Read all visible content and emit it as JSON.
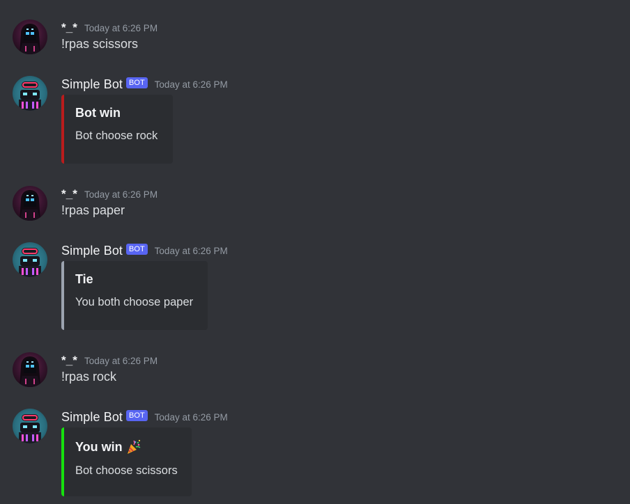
{
  "colors": {
    "background": "#313338",
    "embed_background": "#2b2d31",
    "bot_tag": "#5865f2",
    "embed_loss": "#b91c1c",
    "embed_tie": "#9ca3af",
    "embed_win": "#16e10e"
  },
  "messages": [
    {
      "author": "*_*",
      "timestamp": "Today at 6:26 PM",
      "content": "!rpas scissors",
      "avatar_icon": "hooded-figure-avatar-icon"
    },
    {
      "author": "Simple Bot",
      "bot_tag": "BOT",
      "timestamp": "Today at 6:26 PM",
      "avatar_icon": "robot-avatar-icon",
      "embed": {
        "title": "Bot win",
        "description": "Bot choose rock",
        "accent": "#b91c1c"
      }
    },
    {
      "author": "*_*",
      "timestamp": "Today at 6:26 PM",
      "content": "!rpas paper",
      "avatar_icon": "hooded-figure-avatar-icon"
    },
    {
      "author": "Simple Bot",
      "bot_tag": "BOT",
      "timestamp": "Today at 6:26 PM",
      "avatar_icon": "robot-avatar-icon",
      "embed": {
        "title": "Tie",
        "description": "You both choose paper",
        "accent": "#9ca3af"
      }
    },
    {
      "author": "*_*",
      "timestamp": "Today at 6:26 PM",
      "content": "!rpas rock",
      "avatar_icon": "hooded-figure-avatar-icon"
    },
    {
      "author": "Simple Bot",
      "bot_tag": "BOT",
      "timestamp": "Today at 6:26 PM",
      "avatar_icon": "robot-avatar-icon",
      "embed": {
        "title": "You win",
        "title_emoji": "party-popper-icon",
        "description": "Bot choose scissors",
        "accent": "#16e10e"
      }
    }
  ]
}
